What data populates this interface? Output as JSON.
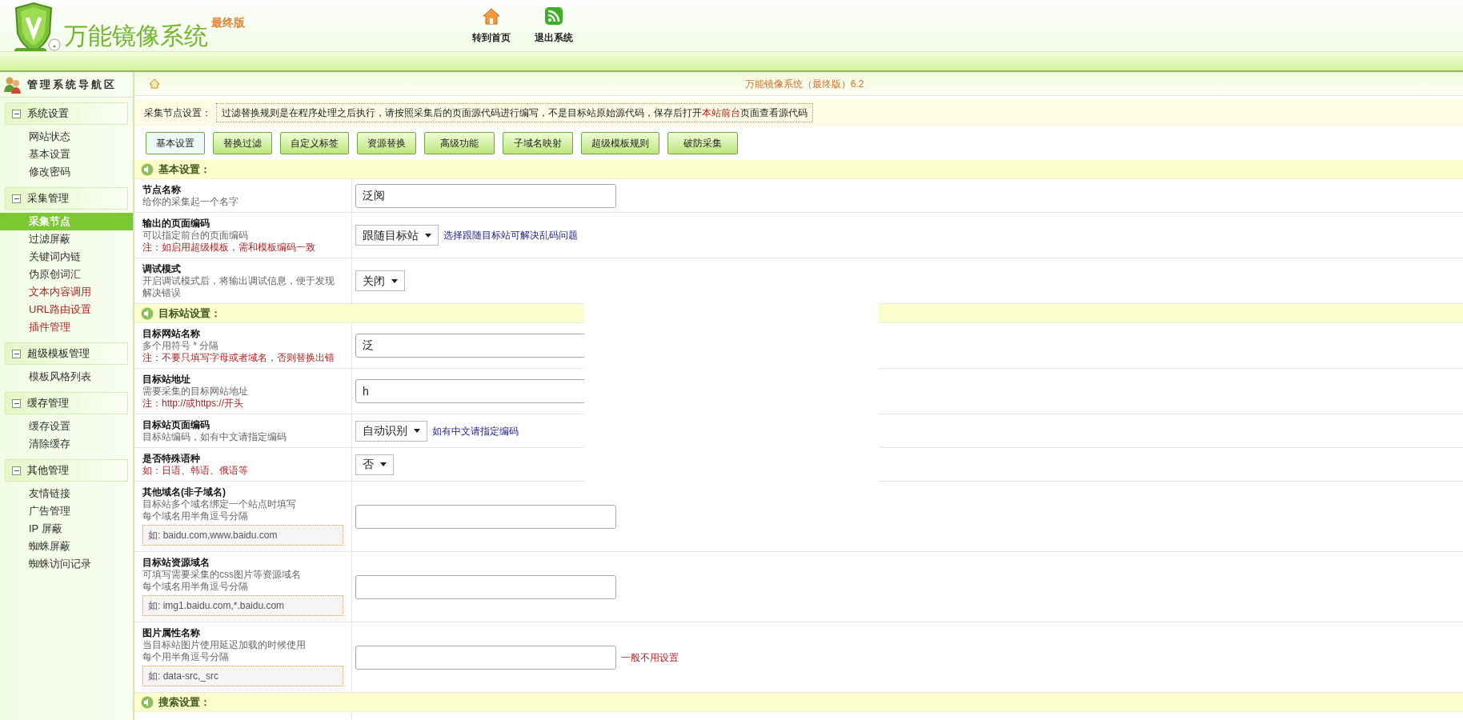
{
  "header": {
    "title": "万能镜像系统",
    "edition": "最终版",
    "nav": [
      {
        "label": "转到首页"
      },
      {
        "label": "退出系统"
      }
    ]
  },
  "sidebar": {
    "title": "管理系统导航区",
    "groups": [
      {
        "title": "系统设置",
        "expanded": true,
        "items": [
          {
            "label": "网站状态",
            "selected": false,
            "kind": "normal"
          },
          {
            "label": "基本设置",
            "selected": false,
            "kind": "normal"
          },
          {
            "label": "修改密码",
            "selected": false,
            "kind": "normal"
          }
        ]
      },
      {
        "title": "采集管理",
        "expanded": true,
        "items": [
          {
            "label": "采集节点",
            "selected": true
          },
          {
            "label": "过滤屏蔽",
            "selected": false,
            "kind": "normal"
          },
          {
            "label": "关键词内链",
            "selected": false,
            "kind": "normal"
          },
          {
            "label": "伪原创词汇",
            "selected": false,
            "kind": "normal"
          },
          {
            "label": "文本内容调用",
            "selected": false,
            "kind": "highlight"
          },
          {
            "label": "URL路由设置",
            "selected": false,
            "kind": "highlight"
          },
          {
            "label": "插件管理",
            "selected": false,
            "kind": "highlight"
          }
        ]
      },
      {
        "title": "超级模板管理",
        "expanded": true,
        "items": [
          {
            "label": "模板风格列表",
            "selected": false,
            "kind": "normal"
          }
        ]
      },
      {
        "title": "缓存管理",
        "expanded": true,
        "items": [
          {
            "label": "缓存设置",
            "selected": false,
            "kind": "normal"
          },
          {
            "label": "清除缓存",
            "selected": false,
            "kind": "normal"
          }
        ]
      },
      {
        "title": "其他管理",
        "expanded": true,
        "items": [
          {
            "label": "友情链接",
            "selected": false,
            "kind": "normal"
          },
          {
            "label": "广告管理",
            "selected": false,
            "kind": "normal"
          },
          {
            "label": "IP 屏蔽",
            "selected": false,
            "kind": "normal"
          },
          {
            "label": "蜘蛛屏蔽",
            "selected": false,
            "kind": "normal"
          },
          {
            "label": "蜘蛛访问记录",
            "selected": false,
            "kind": "normal"
          }
        ]
      }
    ]
  },
  "main": {
    "title": "万能镜像系统（最终版）6.2",
    "notice": {
      "label": "采集节点设置：",
      "before": "过滤替换规则是在程序处理之后执行，请按照采集后的页面源代码进行编写，不是目标站原始源代码，保存后打开",
      "link": "本站前台",
      "after": "页面查看源代码"
    },
    "tabs": [
      {
        "label": "基本设置",
        "selected": true
      },
      {
        "label": "替换过滤",
        "selected": false
      },
      {
        "label": "自定义标签",
        "selected": false
      },
      {
        "label": "资源替换",
        "selected": false
      },
      {
        "label": "高级功能",
        "selected": false
      },
      {
        "label": "子域名映射",
        "selected": false
      },
      {
        "label": "超级模板规则",
        "selected": false
      },
      {
        "label": "破防采集",
        "selected": false
      }
    ],
    "sections": [
      {
        "title": "基本设置：",
        "rows": [
          {
            "label": "节点名称",
            "hints": [
              {
                "text": "给你的采集起一个名字",
                "kind": "hint"
              }
            ],
            "control": {
              "kind": "text",
              "value": "泛阅"
            }
          },
          {
            "label": "输出的页面编码",
            "hints": [
              {
                "text": "可以指定前台的页面编码",
                "kind": "hint"
              },
              {
                "text": "注：如启用超级模板，需和模板编码一致",
                "kind": "note"
              }
            ],
            "control": {
              "kind": "select",
              "value": "跟随目标站"
            },
            "aside": {
              "text": "选择跟随目标站可解决乱码问题",
              "kind": "info"
            }
          },
          {
            "label": "调试模式",
            "hints": [
              {
                "text": "开启调试模式后，将输出调试信息，便于发现解决错误",
                "kind": "hint"
              }
            ],
            "control": {
              "kind": "select",
              "value": "关闭"
            }
          }
        ]
      },
      {
        "title": "目标站设置：",
        "rows": [
          {
            "label": "目标网站名称",
            "hints": [
              {
                "text": "多个用符号 * 分隔",
                "kind": "hint"
              },
              {
                "text": "注：不要只填写字母或者域名，否则替换出错",
                "kind": "note"
              }
            ],
            "control": {
              "kind": "text",
              "value": "泛"
            }
          },
          {
            "label": "目标站地址",
            "hints": [
              {
                "text": "需要采集的目标网站地址",
                "kind": "hint"
              },
              {
                "text": "注：http://或https://开头",
                "kind": "note"
              }
            ],
            "control": {
              "kind": "text",
              "value": "h"
            }
          },
          {
            "label": "目标站页面编码",
            "hints": [
              {
                "text": "目标站编码，如有中文请指定编码",
                "kind": "hint"
              }
            ],
            "control": {
              "kind": "select",
              "value": "自动识别"
            },
            "aside": {
              "text": "如有中文请指定编码",
              "kind": "info"
            }
          },
          {
            "label": "是否特殊语种",
            "hints": [
              {
                "text": "如：日语、韩语、俄语等",
                "kind": "note"
              }
            ],
            "control": {
              "kind": "select",
              "value": "否"
            }
          },
          {
            "label": "其他域名(非子域名)",
            "hints": [
              {
                "text": "目标站多个域名绑定一个站点时填写",
                "kind": "hint"
              },
              {
                "text": "每个域名用半角逗号分隔",
                "kind": "hint"
              }
            ],
            "example": "如: baidu.com,www.baidu.com",
            "control": {
              "kind": "text"
            }
          },
          {
            "label": "目标站资源域名",
            "hints": [
              {
                "text": "可填写需要采集的css图片等资源域名",
                "kind": "hint"
              },
              {
                "text": "每个域名用半角逗号分隔",
                "kind": "hint"
              }
            ],
            "example": "如: img1.baidu.com,*.baidu.com",
            "control": {
              "kind": "text"
            }
          },
          {
            "label": "图片属性名称",
            "hints": [
              {
                "text": "当目标站图片使用延迟加载的时候使用",
                "kind": "hint"
              },
              {
                "text": "每个用半角逗号分隔",
                "kind": "hint"
              }
            ],
            "example": "如: data-src,_src",
            "control": {
              "kind": "text"
            },
            "aside": {
              "text": "一般不用设置",
              "kind": "warning"
            }
          }
        ]
      },
      {
        "title": "搜索设置："
      }
    ]
  }
}
